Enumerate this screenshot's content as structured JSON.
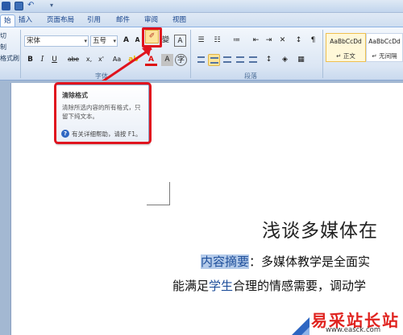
{
  "tabs": [
    "始",
    "插入",
    "页面布局",
    "引用",
    "邮件",
    "审阅",
    "视图"
  ],
  "clipboard": {
    "items": [
      "切",
      "制",
      "格式刷"
    ]
  },
  "font_group": {
    "font_name": "宋体",
    "font_size": "五号",
    "grow_label": "A",
    "shrink_label": "A",
    "bold": "B",
    "italic": "I",
    "underline": "U",
    "strike": "abe",
    "subscript": "x,",
    "superscript": "x'",
    "change_case": "Aa",
    "phonetic": "變",
    "border_char": "A",
    "font_color": "A",
    "shade_char": "A",
    "enclose_char": "字",
    "group_label": "字体"
  },
  "paragraph_group": {
    "group_label": "段落"
  },
  "styles": {
    "cards": [
      {
        "sample": "AaBbCcDd",
        "name": "↵ 正文"
      },
      {
        "sample": "AaBbCcDd",
        "name": "↵ 无间隔"
      }
    ]
  },
  "tooltip": {
    "title": "清除格式",
    "description": "清除所选内容的所有格式，只留下纯文本。",
    "help": "有关详细帮助，请按 F1。",
    "help_icon": "?"
  },
  "document": {
    "title": "浅谈多媒体在",
    "line1_highlight": "内容摘要",
    "line1_rest": "：多媒体教学是全面实",
    "line2_a": "能满足",
    "line2_blue": "学生",
    "line2_b": "合理的情感需要，调动学"
  },
  "watermark": {
    "text": "易采站长站",
    "url": "www.easck.com"
  },
  "colors": {
    "highlight_red": "#e0141e",
    "accent_blue": "#1d4e9a",
    "active_button": "#fde49a"
  },
  "icons": {
    "clear_formatting": "eraser-icon",
    "help": "question-circle-icon"
  }
}
